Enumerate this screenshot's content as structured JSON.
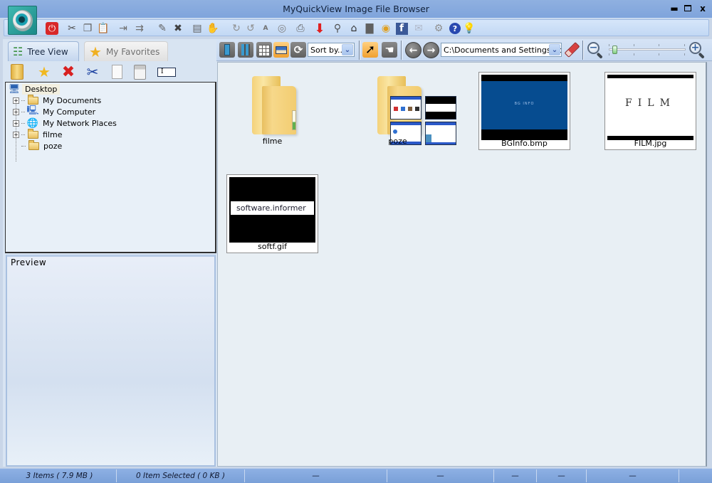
{
  "window": {
    "title": "MyQuickView Image File Browser",
    "controls": {
      "minimize": "_",
      "close": "x"
    }
  },
  "main_toolbar": {
    "icons": [
      {
        "name": "power-icon",
        "glyph": "⏻",
        "color": "#d02020"
      },
      {
        "name": "cut-icon",
        "glyph": "✂",
        "color": "#505050"
      },
      {
        "name": "copy-icon",
        "glyph": "❐",
        "color": "#606060"
      },
      {
        "name": "paste-icon",
        "glyph": "📋",
        "color": "#606060"
      },
      {
        "name": "move-to-icon",
        "glyph": "⇥",
        "color": "#707070"
      },
      {
        "name": "copy-to-icon",
        "glyph": "⇉",
        "color": "#707070"
      },
      {
        "name": "edit-icon",
        "glyph": "✎",
        "color": "#606060"
      },
      {
        "name": "delete-file-icon",
        "glyph": "✖",
        "color": "#404040"
      },
      {
        "name": "properties-icon",
        "glyph": "▤",
        "color": "#606060"
      },
      {
        "name": "set-wallpaper-icon",
        "glyph": "✋",
        "color": "#505050"
      },
      {
        "name": "rotate-right-icon",
        "glyph": "↻",
        "color": "#909090"
      },
      {
        "name": "rotate-left-icon",
        "glyph": "↺",
        "color": "#909090"
      },
      {
        "name": "auto-rotate-icon",
        "glyph": "A",
        "color": "#707070"
      },
      {
        "name": "compass-icon",
        "glyph": "◎",
        "color": "#808080"
      },
      {
        "name": "print-icon",
        "glyph": "⎙",
        "color": "#606060"
      },
      {
        "name": "download-icon",
        "glyph": "⬇",
        "color": "#e02020"
      },
      {
        "name": "search-icon",
        "glyph": "⚲",
        "color": "#505050"
      },
      {
        "name": "slideshow-icon",
        "glyph": "⌂",
        "color": "#303030"
      },
      {
        "name": "monitor-icon",
        "glyph": "▇",
        "color": "#606060"
      },
      {
        "name": "burn-cd-icon",
        "glyph": "◉",
        "color": "#e0a020"
      },
      {
        "name": "facebook-icon",
        "glyph": "f",
        "color": "#3b5998"
      },
      {
        "name": "email-icon",
        "glyph": "✉",
        "color": "#b0b8c8"
      },
      {
        "name": "settings-icon",
        "glyph": "⚙",
        "color": "#909090"
      },
      {
        "name": "help-icon",
        "glyph": "?",
        "color": "#2040a0"
      },
      {
        "name": "tip-bulb-icon",
        "glyph": "💡",
        "color": "#f0c020"
      }
    ]
  },
  "left_panel": {
    "tabs": [
      {
        "label": "Tree View",
        "active": true
      },
      {
        "label": "My Favorites",
        "active": false
      }
    ],
    "tools": [
      {
        "name": "folder-icon",
        "glyph": "📁"
      },
      {
        "name": "add-favorite-icon",
        "glyph": "★"
      },
      {
        "name": "delete-icon",
        "glyph": "✖"
      },
      {
        "name": "cut-icon",
        "glyph": "✂"
      },
      {
        "name": "copy-icon",
        "glyph": "❐"
      },
      {
        "name": "paste-icon",
        "glyph": "📋"
      }
    ],
    "rename_field": "I",
    "tree": {
      "root": "Desktop",
      "children": [
        {
          "label": "My Documents",
          "expandable": true,
          "icon": "my-documents-icon"
        },
        {
          "label": "My Computer",
          "expandable": true,
          "icon": "my-computer-icon"
        },
        {
          "label": "My Network Places",
          "expandable": true,
          "icon": "network-places-icon"
        },
        {
          "label": "filme",
          "expandable": true,
          "icon": "folder-icon"
        },
        {
          "label": "poze",
          "expandable": false,
          "icon": "folder-icon"
        }
      ]
    },
    "preview_title": "Preview"
  },
  "browser_toolbar": {
    "sort_label": "Sort by..",
    "path": "C:\\Documents and Settings\\Ac",
    "zoom_level_fraction": 0.05
  },
  "files": [
    {
      "name": "filme",
      "type": "folder"
    },
    {
      "name": "poze",
      "type": "folder-with-images"
    },
    {
      "name": "BGInfo.bmp",
      "type": "image",
      "thumb_text": "BG INFO"
    },
    {
      "name": "FILM.jpg",
      "type": "image",
      "thumb_text": "FILM"
    },
    {
      "name": "softf.gif",
      "type": "image",
      "thumb_text": "software.informer"
    }
  ],
  "status_bar": {
    "items": "3 Items ( 7.9 MB )",
    "selected": "0 Item Selected ( 0 KB )",
    "cells": [
      "—",
      "—",
      "—",
      "—",
      "—",
      ""
    ]
  }
}
